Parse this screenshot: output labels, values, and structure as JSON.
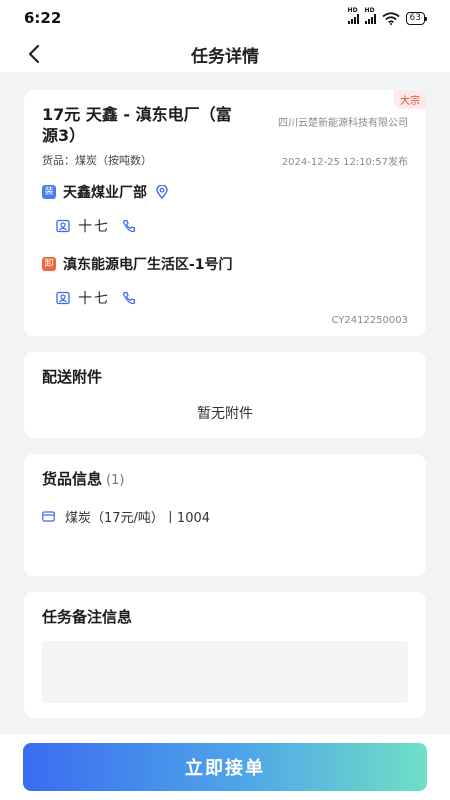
{
  "status_bar": {
    "time": "6:22",
    "signal_label": "HD",
    "battery": "63"
  },
  "header": {
    "title": "任务详情"
  },
  "task": {
    "bulk_tag": "大宗",
    "route_title": "17元 天鑫 - 滇东电厂（富源3）",
    "company": "四川云楚新能源科技有限公司",
    "goods_line": "货品：煤炭（按吨数）",
    "publish_time": "2024-12-25 12:10:57发布",
    "load_badge": "装",
    "load_name": "天鑫煤业厂部",
    "load_contact": "十七",
    "unload_badge": "卸",
    "unload_name": "滇东能源电厂生活区-1号门",
    "unload_contact": "十七",
    "order_no": "CY2412250003"
  },
  "attachments": {
    "title": "配送附件",
    "empty_text": "暂无附件"
  },
  "goods_info": {
    "title": "货品信息",
    "count": "(1)",
    "items": [
      {
        "text": "煤炭（17元/吨）丨1004"
      }
    ]
  },
  "remarks": {
    "title": "任务备注信息",
    "value": ""
  },
  "actions": {
    "accept_label": "立即接单"
  },
  "colors": {
    "accent": "#3a6cf0",
    "load": "#4a7cf5",
    "unload": "#ee6a3d",
    "tag": "#e64a3b"
  }
}
